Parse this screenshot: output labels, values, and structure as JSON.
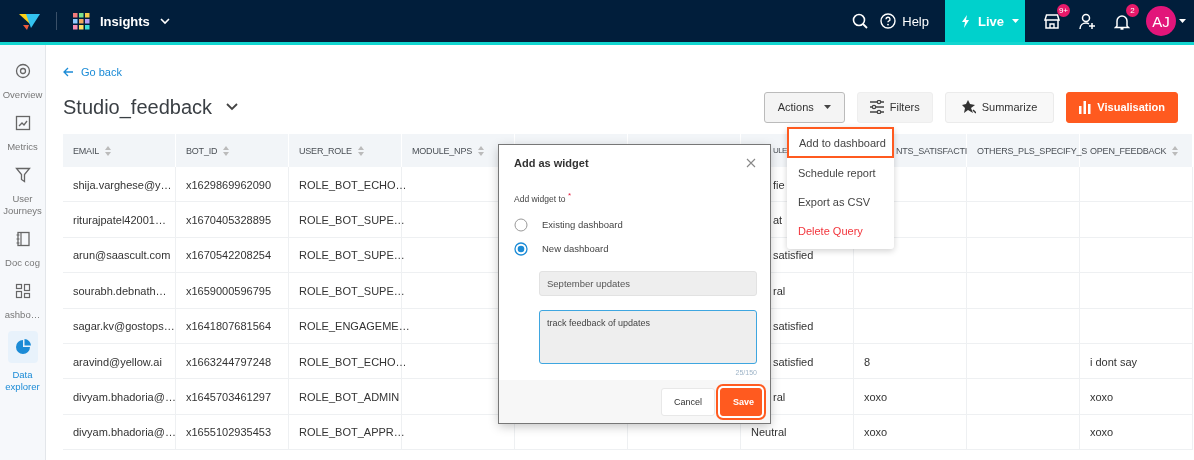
{
  "topbar": {
    "app": "Insights",
    "help": "Help",
    "env": "Live",
    "store_badge": "9+",
    "notif_badge": "2",
    "avatar": "AJ"
  },
  "sidebar": {
    "items": [
      {
        "label": "Overview",
        "selected": false
      },
      {
        "label": "Metrics",
        "selected": false
      },
      {
        "label": "User Journeys",
        "selected": false
      },
      {
        "label": "Doc cog",
        "selected": false
      },
      {
        "label": "ashbo…",
        "selected": false
      },
      {
        "label": "Data explorer",
        "selected": true
      }
    ]
  },
  "page": {
    "back": "Go back",
    "title": "Studio_feedback",
    "buttons": [
      {
        "label": "Actions",
        "kind": "dropdown"
      },
      {
        "label": "Filters",
        "kind": "secondary"
      },
      {
        "label": "Summarize",
        "kind": "plain"
      },
      {
        "label": "Visualisation",
        "kind": "primary"
      }
    ]
  },
  "table": {
    "columns": [
      {
        "label": "EMAIL",
        "sortable": true
      },
      {
        "label": "BOT_ID",
        "sortable": true
      },
      {
        "label": "USER_ROLE",
        "sortable": true
      },
      {
        "label": "MODULE_NPS",
        "sortable": true
      },
      null,
      null,
      {
        "label": "ULE",
        "sortable": false,
        "cut": true
      },
      {
        "label": "NTS_SATISFACTI",
        "sortable": false,
        "cut": true
      },
      {
        "label": "OTHERS_PLS_SPECIFY_S",
        "sortable": false
      },
      {
        "label": "OPEN_FEEDBACK",
        "sortable": true
      }
    ],
    "rows": [
      {
        "cells": [
          "shija.varghese@y…",
          "x1629869962090",
          "ROLE_BOT_ECHO…",
          null,
          null,
          null,
          {
            "text": "fie",
            "cut": true
          },
          null,
          null,
          null
        ]
      },
      {
        "cells": [
          "riturajpatel42001…",
          "x1670405328895",
          "ROLE_BOT_SUPE…",
          null,
          null,
          null,
          {
            "text": "at",
            "cut": true
          },
          null,
          null,
          null
        ]
      },
      {
        "cells": [
          "arun@saascult.com",
          "x1670542208254",
          "ROLE_BOT_SUPE…",
          null,
          null,
          null,
          {
            "text": "satisfied",
            "cut": true
          },
          null,
          null,
          null
        ]
      },
      {
        "cells": [
          "sourabh.debnath…",
          "x1659000596795",
          "ROLE_BOT_SUPE…",
          null,
          null,
          null,
          {
            "text": "ral",
            "cut": true
          },
          null,
          null,
          null
        ]
      },
      {
        "cells": [
          "sagar.kv@gostops…",
          "x1641807681564",
          "ROLE_ENGAGEME…",
          null,
          null,
          null,
          {
            "text": "satisfied",
            "cut": true
          },
          null,
          null,
          null
        ]
      },
      {
        "cells": [
          "aravind@yellow.ai",
          "x1663244797248",
          "ROLE_BOT_ECHO…",
          null,
          null,
          null,
          {
            "text": "satisfied",
            "cut": true
          },
          "8",
          null,
          "i dont say"
        ]
      },
      {
        "cells": [
          "divyam.bhadoria@…",
          "x1645703461297",
          "ROLE_BOT_ADMIN",
          null,
          null,
          null,
          {
            "text": "ral",
            "cut": true
          },
          "xoxo",
          null,
          "xoxo"
        ]
      },
      {
        "cells": [
          "divyam.bhadoria@…",
          "x1655102935453",
          "ROLE_BOT_APPR…",
          null,
          null,
          null,
          "Neutral",
          "xoxo",
          null,
          "xoxo"
        ]
      }
    ]
  },
  "actions_menu": {
    "items": [
      {
        "label": "Add to dashboard",
        "kind": "normal",
        "highlighted": true
      },
      {
        "label": "Schedule report",
        "kind": "normal",
        "highlighted": false
      },
      {
        "label": "Export as CSV",
        "kind": "normal",
        "highlighted": false
      },
      {
        "label": "Delete Query",
        "kind": "danger",
        "highlighted": false
      }
    ]
  },
  "dialog": {
    "title": "Add as widget",
    "field_label": "Add widget to $^{*}$",
    "options": [
      {
        "label": "Existing dashboard",
        "selected": false
      },
      {
        "label": "New dashboard",
        "selected": true
      }
    ],
    "name_field": {
      "value": "September updates"
    },
    "description_field": {
      "value": "track feedback of updates",
      "focused": true
    },
    "counter": "25/150",
    "buttons": [
      {
        "label": "Cancel",
        "kind": "secondary",
        "highlighted": false
      },
      {
        "label": "Save",
        "kind": "primary",
        "highlighted": true
      }
    ]
  }
}
